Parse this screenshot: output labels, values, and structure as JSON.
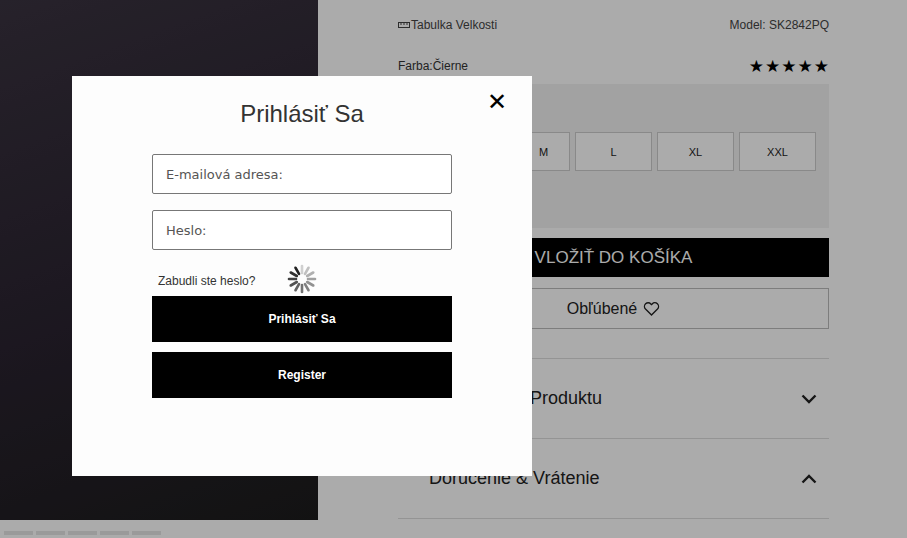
{
  "product": {
    "size_chart": "Tabulka Velkosti",
    "model": "Model: SK2842PQ",
    "color_label": "Farba:Čierne",
    "rating": {
      "star": "★",
      "stars": 5,
      "max": 5
    },
    "sizes": [
      {
        "label": "M",
        "selected": false
      },
      {
        "label": "L",
        "selected": false
      },
      {
        "label": "XL",
        "selected": false
      },
      {
        "label": "XXL",
        "selected": false
      }
    ],
    "add_to_cart": "VLOŽIŤ DO KOŠÍKA",
    "favorite": "Obľúbené",
    "sections": [
      {
        "title": "Produktu",
        "expanded": false
      },
      {
        "title": "Doručenie & Vrátenie",
        "expanded": true
      }
    ]
  },
  "gallery": {
    "indicators": [
      {
        "selected": false
      },
      {
        "selected": false
      },
      {
        "selected": false
      },
      {
        "selected": false
      },
      {
        "selected": false
      }
    ]
  },
  "login": {
    "title": "Prihlásiť Sa",
    "close": "✕",
    "fields": [
      {
        "placeholder": "E-mailová adresa:",
        "value": ""
      },
      {
        "placeholder": "Heslo:",
        "value": ""
      }
    ],
    "forgot": "Zabudli ste heslo?",
    "loading": true,
    "buttons": [
      "Prihlásiť Sa",
      "Register"
    ]
  }
}
